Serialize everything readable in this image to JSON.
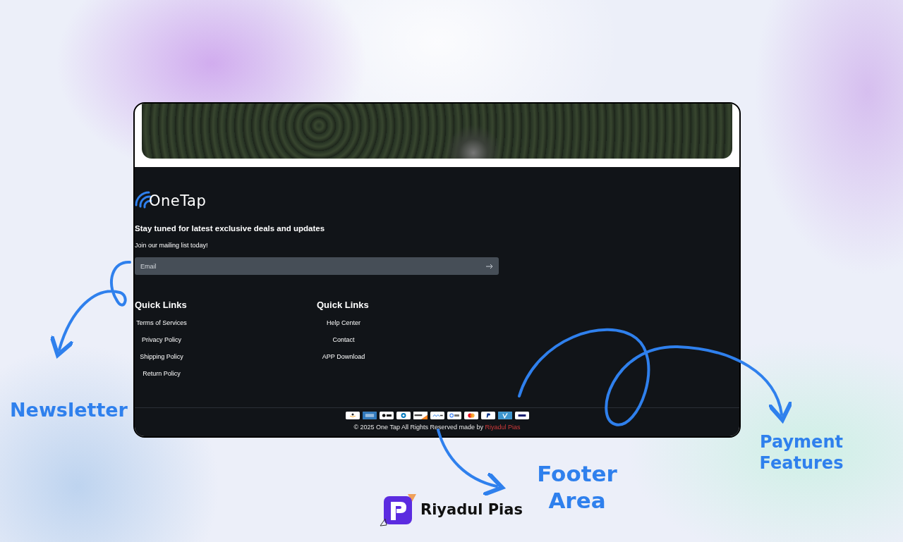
{
  "annotations": [
    {
      "kind": "newsletter",
      "text": "Newsletter"
    },
    {
      "kind": "footer",
      "text": "Footer Area"
    },
    {
      "kind": "payment",
      "text": "Payment Features"
    }
  ],
  "footer": {
    "brand": "OneTap",
    "headline": "Stay tuned for latest exclusive deals and updates",
    "subline": "Join our mailing list today!",
    "email": {
      "placeholder": "Email"
    },
    "link_columns": [
      {
        "heading": "Quick Links",
        "links": [
          "Terms of Services",
          "Privacy Policy",
          "Shipping Policy",
          "Return Policy"
        ]
      },
      {
        "heading": "Quick Links",
        "links": [
          "Help Center",
          "Contact",
          "APP Download"
        ]
      }
    ],
    "payment_methods": [
      {
        "kind": "amazon"
      },
      {
        "kind": "amex"
      },
      {
        "kind": "applepay"
      },
      {
        "kind": "diners"
      },
      {
        "kind": "discover"
      },
      {
        "kind": "meta"
      },
      {
        "kind": "gpay"
      },
      {
        "kind": "mastercard"
      },
      {
        "kind": "paypal"
      },
      {
        "kind": "venmo"
      },
      {
        "kind": "visa"
      }
    ],
    "copyright": "© 2025 One Tap All Rights Reserved made by **Riyadul Pias**"
  },
  "author": {
    "name": "Riyadul Pias"
  }
}
